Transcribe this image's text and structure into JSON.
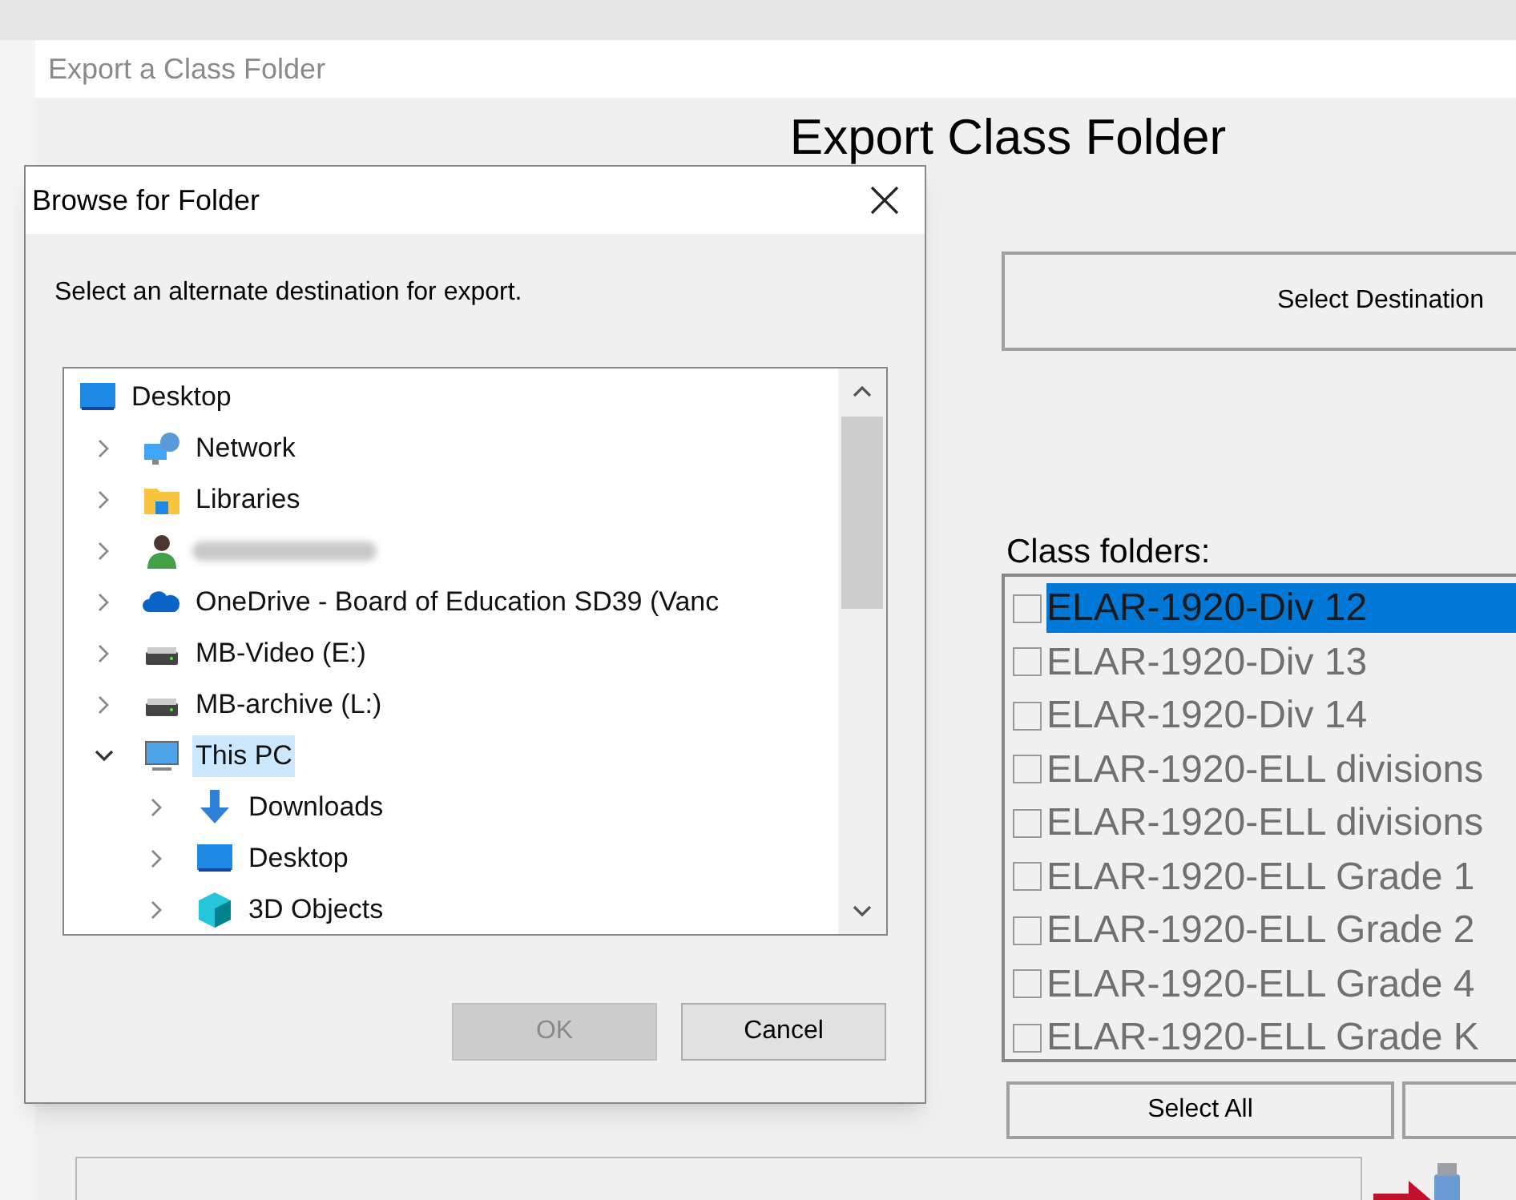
{
  "window": {
    "title": "Export a Class Folder",
    "heading": "Export Class Folder"
  },
  "select_destination_button": "Select Destination",
  "class_folders": {
    "label": "Class folders:",
    "items": [
      {
        "name": "ELAR-1920-Div 12",
        "checked": false,
        "selected": true
      },
      {
        "name": "ELAR-1920-Div 13",
        "checked": false,
        "selected": false
      },
      {
        "name": "ELAR-1920-Div 14",
        "checked": false,
        "selected": false
      },
      {
        "name": "ELAR-1920-ELL divisions",
        "checked": false,
        "selected": false
      },
      {
        "name": "ELAR-1920-ELL divisions",
        "checked": false,
        "selected": false
      },
      {
        "name": "ELAR-1920-ELL Grade 1",
        "checked": false,
        "selected": false
      },
      {
        "name": "ELAR-1920-ELL Grade 2",
        "checked": false,
        "selected": false
      },
      {
        "name": "ELAR-1920-ELL Grade 4",
        "checked": false,
        "selected": false
      },
      {
        "name": "ELAR-1920-ELL Grade K",
        "checked": false,
        "selected": false
      }
    ]
  },
  "list_buttons": [
    "Select All"
  ],
  "dialog": {
    "title": "Browse for Folder",
    "prompt": "Select an alternate destination for export.",
    "tree": [
      {
        "label": "Desktop",
        "kind": "desktop",
        "selected": false,
        "children": [
          {
            "label": "Network",
            "kind": "network",
            "selected": false,
            "expanded": false
          },
          {
            "label": "Libraries",
            "kind": "libraries",
            "selected": false,
            "expanded": false
          },
          {
            "kind": "redacted",
            "expanded": false
          },
          {
            "label": "OneDrive - Board of Education SD39 (Vanc",
            "kind": "cloud",
            "selected": false,
            "expanded": false
          },
          {
            "label": "MB-Video (E:)",
            "kind": "drive",
            "selected": false,
            "expanded": false
          },
          {
            "label": "MB-archive (L:)",
            "kind": "drive",
            "selected": false,
            "expanded": false
          },
          {
            "label": "This PC",
            "kind": "pc",
            "selected": true,
            "expanded": true,
            "children": [
              {
                "label": "Downloads",
                "kind": "download",
                "selected": false,
                "expanded": false
              },
              {
                "label": "Desktop",
                "kind": "desktop",
                "selected": false,
                "expanded": false
              },
              {
                "label": "3D Objects",
                "kind": "cube",
                "selected": false,
                "expanded": false
              }
            ]
          }
        ]
      }
    ],
    "buttons": [
      {
        "label": "OK",
        "disabled": true
      },
      {
        "label": "Cancel",
        "disabled": false
      }
    ]
  }
}
